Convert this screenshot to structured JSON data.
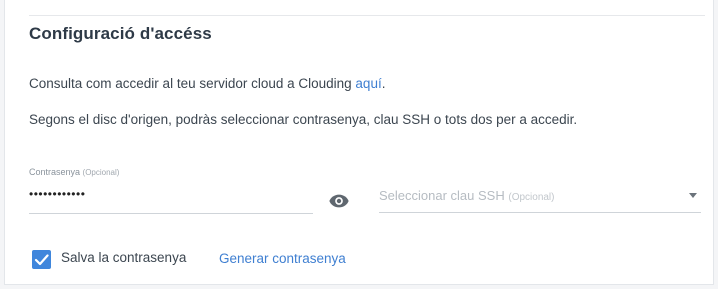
{
  "section": {
    "title": "Configuració d'accéss",
    "intro_text": "Consulta com accedir al teu servidor cloud a Clouding ",
    "intro_link": "aquí",
    "intro_end": ".",
    "info_text": "Segons el disc d'origen, podràs seleccionar contrasenya, clau SSH o tots dos per a accedir."
  },
  "password_field": {
    "label": "Contrasenya",
    "label_optional": "(Opcional)",
    "value": "••••••••••••"
  },
  "ssh_select": {
    "placeholder": "Seleccionar clau SSH",
    "placeholder_optional": "(Opcional)"
  },
  "save_password": {
    "checked": true,
    "label": "Salva la contrasenya"
  },
  "generate_link": "Generar contrasenya",
  "colors": {
    "accent": "#3f86dc",
    "link": "#3f7fd1",
    "title": "#2e3a47"
  },
  "icons": {
    "password_toggle": "eye-icon",
    "select_arrow": "caret-down-icon",
    "checkbox_mark": "check-icon"
  }
}
